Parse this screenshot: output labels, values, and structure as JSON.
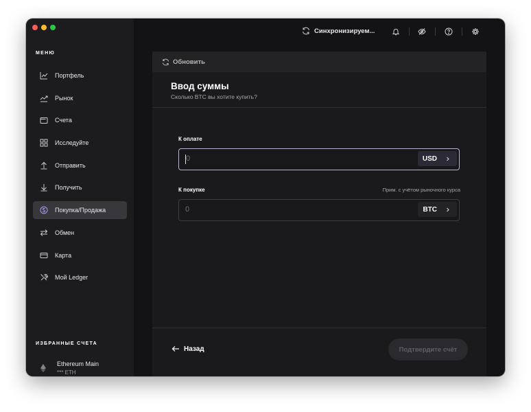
{
  "sidebar": {
    "menu_title": "МЕНЮ",
    "items": [
      {
        "label": "Портфель",
        "icon": "chart-line-icon",
        "active": false
      },
      {
        "label": "Рынок",
        "icon": "trend-icon",
        "active": false
      },
      {
        "label": "Счета",
        "icon": "wallet-icon",
        "active": false
      },
      {
        "label": "Исследуйте",
        "icon": "grid-icon",
        "active": false
      },
      {
        "label": "Отправить",
        "icon": "arrow-up-icon",
        "active": false
      },
      {
        "label": "Получить",
        "icon": "arrow-down-icon",
        "active": false
      },
      {
        "label": "Покупка/Продажа",
        "icon": "dollar-coin-icon",
        "active": true
      },
      {
        "label": "Обмен",
        "icon": "swap-icon",
        "active": false
      },
      {
        "label": "Карта",
        "icon": "card-icon",
        "active": false
      },
      {
        "label": "Мой Ledger",
        "icon": "tools-icon",
        "active": false
      }
    ],
    "favorites_title": "ИЗБРАННЫЕ СЧЕТА",
    "favorites": [
      {
        "name": "Ethereum Main",
        "balance": "*** ETH",
        "icon": "ethereum-icon"
      }
    ]
  },
  "topbar": {
    "sync_label": "Синхронизируем...",
    "icons": [
      "bell-icon",
      "eye-off-icon",
      "help-icon",
      "gear-icon"
    ]
  },
  "panel": {
    "refresh_label": "Обновить",
    "title": "Ввод суммы",
    "subtitle": "Сколько BTC вы хотите купить?",
    "pay": {
      "label": "К оплате",
      "value": "0",
      "currency": "USD"
    },
    "receive": {
      "label": "К покупке",
      "hint": "Прим. с учётом рыночного курса",
      "value": "0",
      "currency": "BTC"
    },
    "back_label": "Назад",
    "confirm_label": "Подтвердите счёт"
  }
}
